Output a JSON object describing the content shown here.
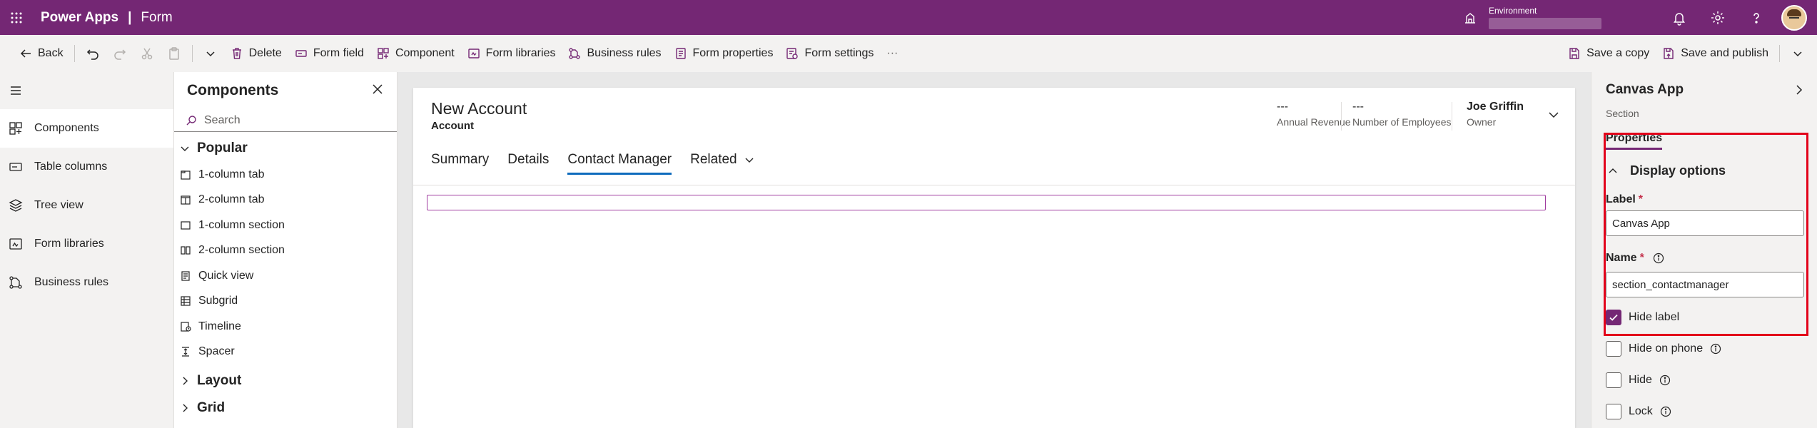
{
  "topbar": {
    "app_name": "Power Apps",
    "separator": "|",
    "page_name": "Form",
    "environment_label": "Environment",
    "icons": [
      "waffle-icon",
      "environment-icon",
      "bell-icon",
      "gear-icon",
      "help-icon"
    ]
  },
  "commands": {
    "back": "Back",
    "delete": "Delete",
    "form_field": "Form field",
    "component": "Component",
    "form_libraries": "Form libraries",
    "business_rules": "Business rules",
    "form_properties": "Form properties",
    "form_settings": "Form settings",
    "more": "···",
    "save_copy": "Save a copy",
    "save_publish": "Save and publish"
  },
  "leftnav": {
    "items": [
      {
        "label": "Components",
        "icon": "components-icon"
      },
      {
        "label": "Table columns",
        "icon": "table-columns-icon"
      },
      {
        "label": "Tree view",
        "icon": "tree-view-icon"
      },
      {
        "label": "Form libraries",
        "icon": "form-libraries-icon"
      },
      {
        "label": "Business rules",
        "icon": "business-rules-icon"
      }
    ]
  },
  "components": {
    "title": "Components",
    "search_placeholder": "Search",
    "popular_label": "Popular",
    "items": [
      "1-column tab",
      "2-column tab",
      "1-column section",
      "2-column section",
      "Quick view",
      "Subgrid",
      "Timeline",
      "Spacer"
    ],
    "layout_label": "Layout",
    "grid_label": "Grid"
  },
  "form": {
    "title": "New Account",
    "entity": "Account",
    "header_fields": [
      {
        "value": "---",
        "label": "Annual Revenue"
      },
      {
        "value": "---",
        "label": "Number of Employees"
      },
      {
        "value": "Joe Griffin",
        "label": "Owner"
      }
    ],
    "tabs": [
      "Summary",
      "Details",
      "Contact Manager",
      "Related"
    ],
    "active_tab": "Contact Manager"
  },
  "properties": {
    "title": "Canvas App",
    "subtitle": "Section",
    "tab": "Properties",
    "group": "Display options",
    "label_field": {
      "label": "Label",
      "required": "*",
      "value": "Canvas App"
    },
    "name_field": {
      "label": "Name",
      "required": "*",
      "value": "section_contactmanager"
    },
    "checkboxes": {
      "hide_label": {
        "label": "Hide label",
        "checked": true
      },
      "hide_on_phone": {
        "label": "Hide on phone",
        "checked": false
      },
      "hide": {
        "label": "Hide",
        "checked": false
      },
      "lock": {
        "label": "Lock",
        "checked": false
      }
    }
  },
  "colors": {
    "brand": "#742774",
    "accent_tab": "#0f6cbd",
    "highlight_box": "#e2001a",
    "owner_link": "#1160b7"
  }
}
